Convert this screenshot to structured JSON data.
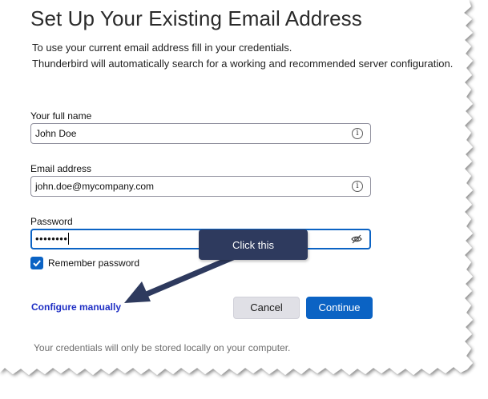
{
  "dialog": {
    "title": "Set Up Your Existing Email Address",
    "intro_line1": "To use your current email address fill in your credentials.",
    "intro_line2": "Thunderbird will automatically search for a working and recommended server configuration."
  },
  "form": {
    "full_name": {
      "label": "Your full name",
      "value": "John Doe",
      "icon": "info-icon"
    },
    "email": {
      "label": "Email address",
      "value": "john.doe@mycompany.com",
      "icon": "info-icon"
    },
    "password": {
      "label": "Password",
      "value": "••••••••",
      "icon": "eye-slash-icon"
    },
    "remember": {
      "label": "Remember password",
      "checked": true
    }
  },
  "actions": {
    "configure_manually": "Configure manually",
    "cancel": "Cancel",
    "continue": "Continue"
  },
  "footer": {
    "note": "Your credentials will only be stored locally on your computer."
  },
  "annotation": {
    "callout": "Click this"
  },
  "colors": {
    "accent": "#0b63c4",
    "link": "#1f2fc4",
    "callout_bg": "#2e3a5e"
  }
}
